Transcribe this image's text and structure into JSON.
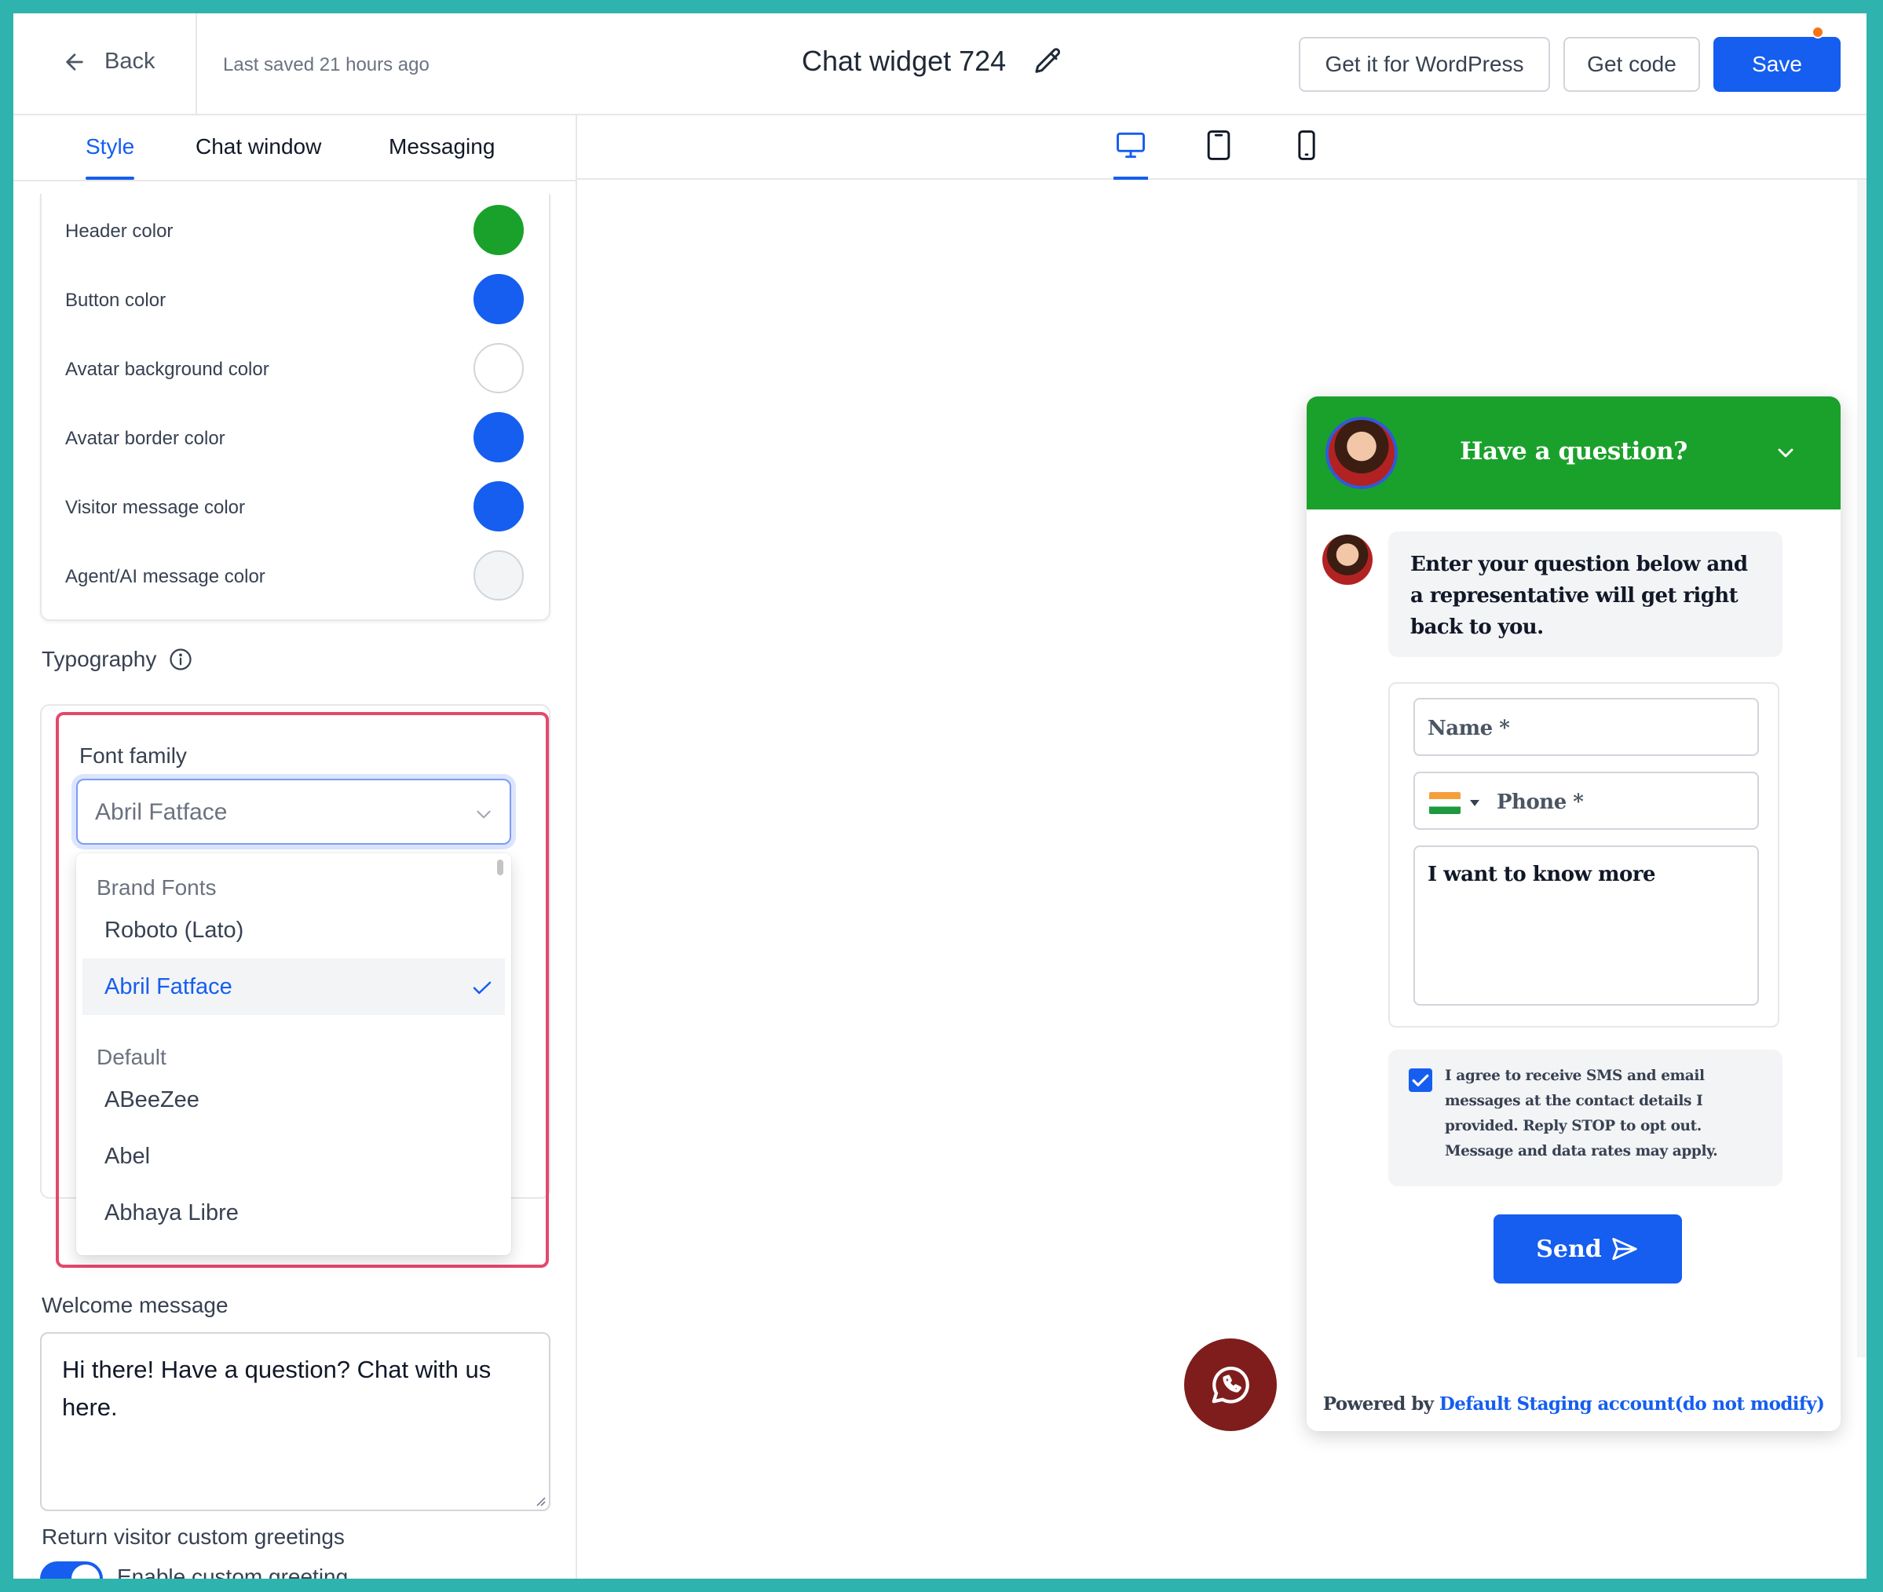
{
  "topbar": {
    "back_label": "Back",
    "last_saved": "Last saved 21 hours ago",
    "title": "Chat widget 724",
    "wordpress_button": "Get it for WordPress",
    "get_code_button": "Get code",
    "save_button": "Save"
  },
  "tabs": [
    {
      "label": "Style",
      "active": true
    },
    {
      "label": "Chat window",
      "active": false
    },
    {
      "label": "Messaging",
      "active": false
    }
  ],
  "colors": [
    {
      "label": "Header color",
      "value": "#1aa12b"
    },
    {
      "label": "Button color",
      "value": "#155eef"
    },
    {
      "label": "Avatar background color",
      "value": "#ffffff"
    },
    {
      "label": "Avatar border color",
      "value": "#155eef"
    },
    {
      "label": "Visitor message color",
      "value": "#155eef"
    },
    {
      "label": "Agent/AI message color",
      "value": "#f3f4f6"
    }
  ],
  "typography": {
    "section_label": "Typography",
    "font_family_label": "Font family",
    "selected_font": "Abril Fatface",
    "dropdown": {
      "group_brand": "Brand Fonts",
      "brand_fonts": [
        "Roboto (Lato)",
        "Abril Fatface"
      ],
      "group_default": "Default",
      "default_fonts": [
        "ABeeZee",
        "Abel",
        "Abhaya Libre"
      ]
    }
  },
  "welcome": {
    "label": "Welcome message",
    "value": "Hi there! Have a question? Chat with us here."
  },
  "return_visitor": {
    "label": "Return visitor custom greetings",
    "toggle_label": "Enable custom greeting",
    "enabled": true
  },
  "devices": [
    "desktop-icon",
    "tablet-icon",
    "mobile-icon"
  ],
  "widget": {
    "header_title": "Have a question?",
    "intro_message": "Enter your question below and a representative will get right back to you.",
    "name_placeholder": "Name *",
    "phone_placeholder": "Phone *",
    "message_value": "I want to know more",
    "consent_text": "I agree to receive SMS and email messages at the contact details I provided. Reply STOP to opt out. Message and data rates may apply.",
    "send_label": "Send",
    "powered_by": "Powered by",
    "powered_link": "Default Staging account(do not modify)",
    "header_color": "#1aa12b",
    "button_color": "#155eef",
    "launcher_color": "#7f1d1d"
  }
}
